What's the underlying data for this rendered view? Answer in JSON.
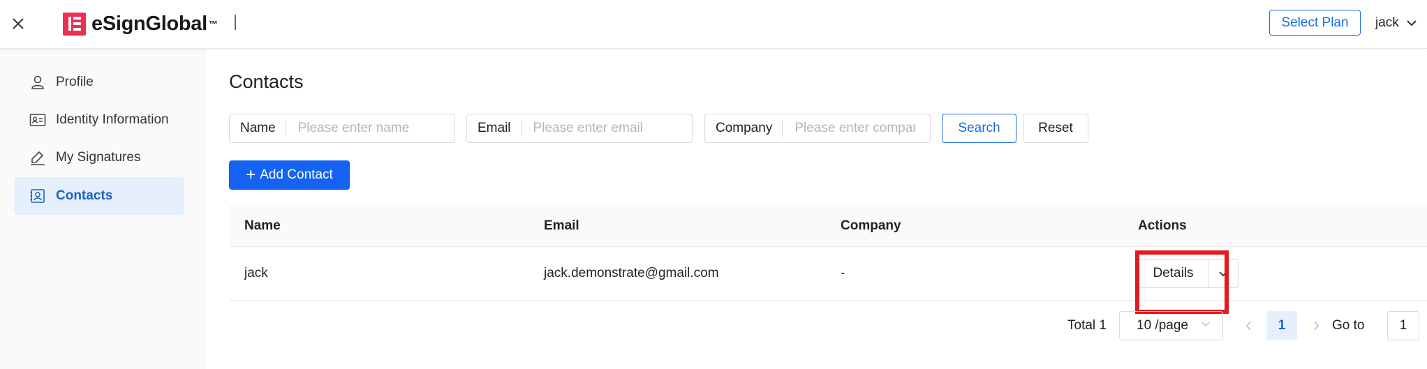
{
  "header": {
    "brand": "eSignGlobal",
    "trademark": "™",
    "select_plan_label": "Select Plan",
    "user_name": "jack",
    "brand_color": "#ef2e55",
    "accent_color": "#1463f3"
  },
  "sidebar": {
    "items": [
      {
        "label": "Profile",
        "icon": "user-icon",
        "active": false
      },
      {
        "label": "Identity Information",
        "icon": "id-card-icon",
        "active": false
      },
      {
        "label": "My Signatures",
        "icon": "signature-icon",
        "active": false
      },
      {
        "label": "Contacts",
        "icon": "contacts-icon",
        "active": true
      }
    ]
  },
  "main": {
    "title": "Contacts",
    "filters": [
      {
        "label": "Name",
        "placeholder": "Please enter name",
        "value": ""
      },
      {
        "label": "Email",
        "placeholder": "Please enter email",
        "value": ""
      },
      {
        "label": "Company",
        "placeholder": "Please enter company",
        "value": ""
      }
    ],
    "search_label": "Search",
    "reset_label": "Reset",
    "add_contact_label": "Add Contact",
    "table": {
      "columns": [
        "Name",
        "Email",
        "Company",
        "Actions"
      ],
      "rows": [
        {
          "name": "jack",
          "email": "jack.demonstrate@gmail.com",
          "company": "-",
          "action_label": "Details"
        }
      ]
    },
    "pagination": {
      "total_text": "Total 1",
      "page_size_text": "10 /page",
      "current_page": "1",
      "goto_label": "Go to",
      "goto_value": "1"
    }
  }
}
